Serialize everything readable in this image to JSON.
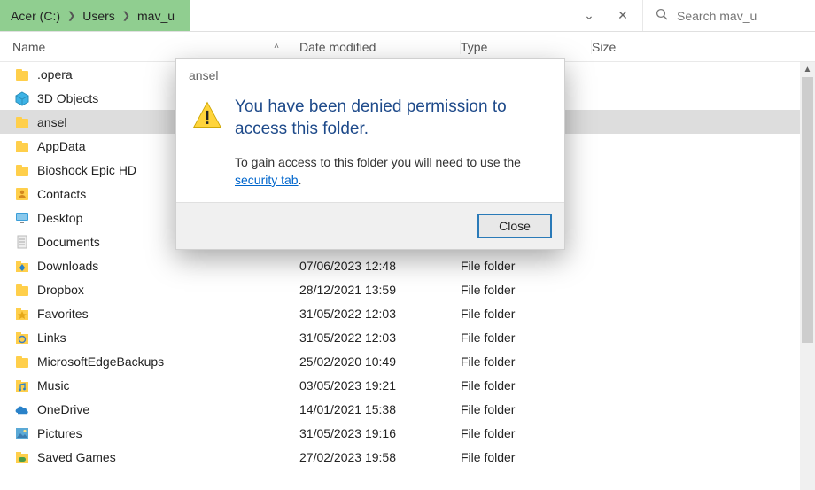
{
  "breadcrumb": {
    "parts": [
      "Acer (C:)",
      "Users",
      "mav_u"
    ]
  },
  "search": {
    "placeholder": "Search mav_u"
  },
  "columns": {
    "name": "Name",
    "date": "Date modified",
    "type": "Type",
    "size": "Size"
  },
  "selected_index": 2,
  "items": [
    {
      "name": ".opera",
      "date": "",
      "type": "",
      "icon": "folder"
    },
    {
      "name": "3D Objects",
      "date": "",
      "type": "",
      "icon": "3d"
    },
    {
      "name": "ansel",
      "date": "",
      "type": "",
      "icon": "folder"
    },
    {
      "name": "AppData",
      "date": "",
      "type": "",
      "icon": "folder"
    },
    {
      "name": "Bioshock Epic HD",
      "date": "",
      "type": "",
      "icon": "folder"
    },
    {
      "name": "Contacts",
      "date": "",
      "type": "",
      "icon": "contacts"
    },
    {
      "name": "Desktop",
      "date": "",
      "type": "",
      "icon": "desktop"
    },
    {
      "name": "Documents",
      "date": "",
      "type": "",
      "icon": "documents"
    },
    {
      "name": "Downloads",
      "date": "07/06/2023 12:48",
      "type": "File folder",
      "icon": "downloads"
    },
    {
      "name": "Dropbox",
      "date": "28/12/2021 13:59",
      "type": "File folder",
      "icon": "folder"
    },
    {
      "name": "Favorites",
      "date": "31/05/2022 12:03",
      "type": "File folder",
      "icon": "favorites"
    },
    {
      "name": "Links",
      "date": "31/05/2022 12:03",
      "type": "File folder",
      "icon": "links"
    },
    {
      "name": "MicrosoftEdgeBackups",
      "date": "25/02/2020 10:49",
      "type": "File folder",
      "icon": "folder"
    },
    {
      "name": "Music",
      "date": "03/05/2023 19:21",
      "type": "File folder",
      "icon": "music"
    },
    {
      "name": "OneDrive",
      "date": "14/01/2021 15:38",
      "type": "File folder",
      "icon": "onedrive"
    },
    {
      "name": "Pictures",
      "date": "31/05/2023 19:16",
      "type": "File folder",
      "icon": "pictures"
    },
    {
      "name": "Saved Games",
      "date": "27/02/2023 19:58",
      "type": "File folder",
      "icon": "savedgames"
    }
  ],
  "dialog": {
    "title": "ansel",
    "heading": "You have been denied permission to access this folder.",
    "message_pre": "To gain access to this folder you will need to use the ",
    "link_text": "security tab",
    "message_post": ".",
    "close": "Close"
  }
}
